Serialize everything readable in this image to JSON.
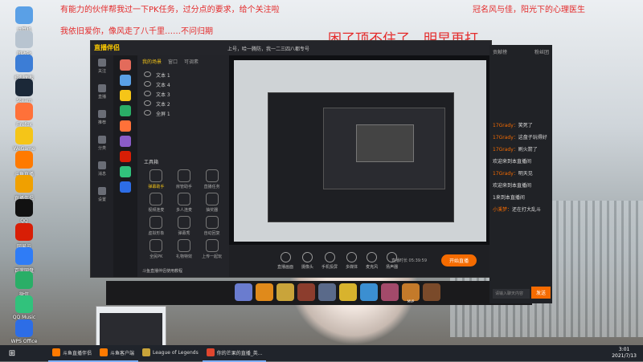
{
  "overlay": {
    "line1": "有能力的伙伴帮我过一下PK任务，过分点的要求，给个关注啦",
    "line2": "冠名风与佳，阳光下的心理医生",
    "line3": "我依旧爱你，像风走了八千里……不问归期",
    "line4": "困了顶不住了，明早再打"
  },
  "desktop_icons": [
    {
      "label": "计算机",
      "color": "#5aa0e6"
    },
    {
      "label": "回收站",
      "color": "#b8c4d0"
    },
    {
      "label": "控制面板",
      "color": "#3c7dd6"
    },
    {
      "label": "Steam",
      "color": "#1b2838"
    },
    {
      "label": "Firefox",
      "color": "#ff7139"
    },
    {
      "label": "WeGame",
      "color": "#f5c518"
    },
    {
      "label": "斗鱼直播",
      "color": "#ff7a00"
    },
    {
      "label": "直播伴侣",
      "color": "#f0a000"
    },
    {
      "label": "QQ",
      "color": "#111"
    },
    {
      "label": "网易云",
      "color": "#d81e06"
    },
    {
      "label": "百度网盘",
      "color": "#2f7cf6"
    },
    {
      "label": "微信",
      "color": "#2aae67"
    },
    {
      "label": "QQ Music",
      "color": "#31c27c"
    },
    {
      "label": "WPS Office",
      "color": "#2d6de6"
    }
  ],
  "app": {
    "logo": "直播伴侣",
    "title": "上号，哈一腾防，我一二三四八都专号",
    "nav": [
      "关注",
      "直播",
      "推荐",
      "分类",
      "消息",
      "设置"
    ],
    "scene_tabs": [
      "我的场景",
      "窗口",
      "可调素"
    ],
    "scenes": [
      "文本 1",
      "文本 4",
      "文本 3",
      "文本 2",
      "全屏 1"
    ],
    "tools_title": "工具箱",
    "tools": [
      "弹幕助手",
      "房管助手",
      "直播任务",
      "视频连麦",
      "多人连麦",
      "抽奖器",
      "虚拟形象",
      "弹幕秀",
      "自动回复",
      "全民PK",
      "礼物特效",
      "上传一起玩"
    ],
    "promo": "斗鱼直播伴侣使用教程",
    "bottom_tools": [
      "直播画面",
      "摄像头",
      "手机投屏",
      "多媒体",
      "麦克风",
      "扬声器"
    ],
    "start_live": "开始直播",
    "status": "直播时长 05:39:59",
    "colors": {
      "accent": "#f56b00",
      "gold": "#f5c518"
    }
  },
  "chat": {
    "tabs": [
      "贡献榜",
      "粉丝团"
    ],
    "messages": [
      {
        "name": "17Grady",
        "text": "笑死了"
      },
      {
        "name": "17Grady",
        "text": "这盘子玩得好"
      },
      {
        "name": "17Grady",
        "text": "刷火箭了"
      },
      {
        "name": "",
        "text": "欢迎来到本直播间"
      },
      {
        "name": "17Grady",
        "text": "明天见"
      },
      {
        "name": "",
        "text": "欢迎来到本直播间"
      },
      {
        "name": "",
        "text": "1来到本直播间"
      },
      {
        "name": "小溪梦",
        "text": "还在打大乱斗"
      }
    ],
    "input_placeholder": "请输入聊天内容",
    "send": "发送"
  },
  "gamebar": [
    {
      "label": "",
      "color": "#6a7ccf"
    },
    {
      "label": "",
      "color": "#e08a1b"
    },
    {
      "label": "",
      "color": "#c9a43a"
    },
    {
      "label": "",
      "color": "#8c3d2d"
    },
    {
      "label": "",
      "color": "#5a6a8a"
    },
    {
      "label": "",
      "color": "#d8b32d"
    },
    {
      "label": "",
      "color": "#3b8fd1"
    },
    {
      "label": "",
      "color": "#a34a6a"
    },
    {
      "label": "MVP",
      "color": "#c47a2a"
    },
    {
      "label": "",
      "color": "#7a4a2a"
    }
  ],
  "taskbar": {
    "items": [
      {
        "label": "斗鱼直播伴侣",
        "color": "#ff7a00"
      },
      {
        "label": "斗鱼客户端",
        "color": "#ff7a00"
      },
      {
        "label": "League of Legends",
        "color": "#c9a43a"
      },
      {
        "label": "你的芒果的直播_英...",
        "color": "#e0462e"
      }
    ],
    "time": "3:01",
    "date": "2021/7/13"
  }
}
